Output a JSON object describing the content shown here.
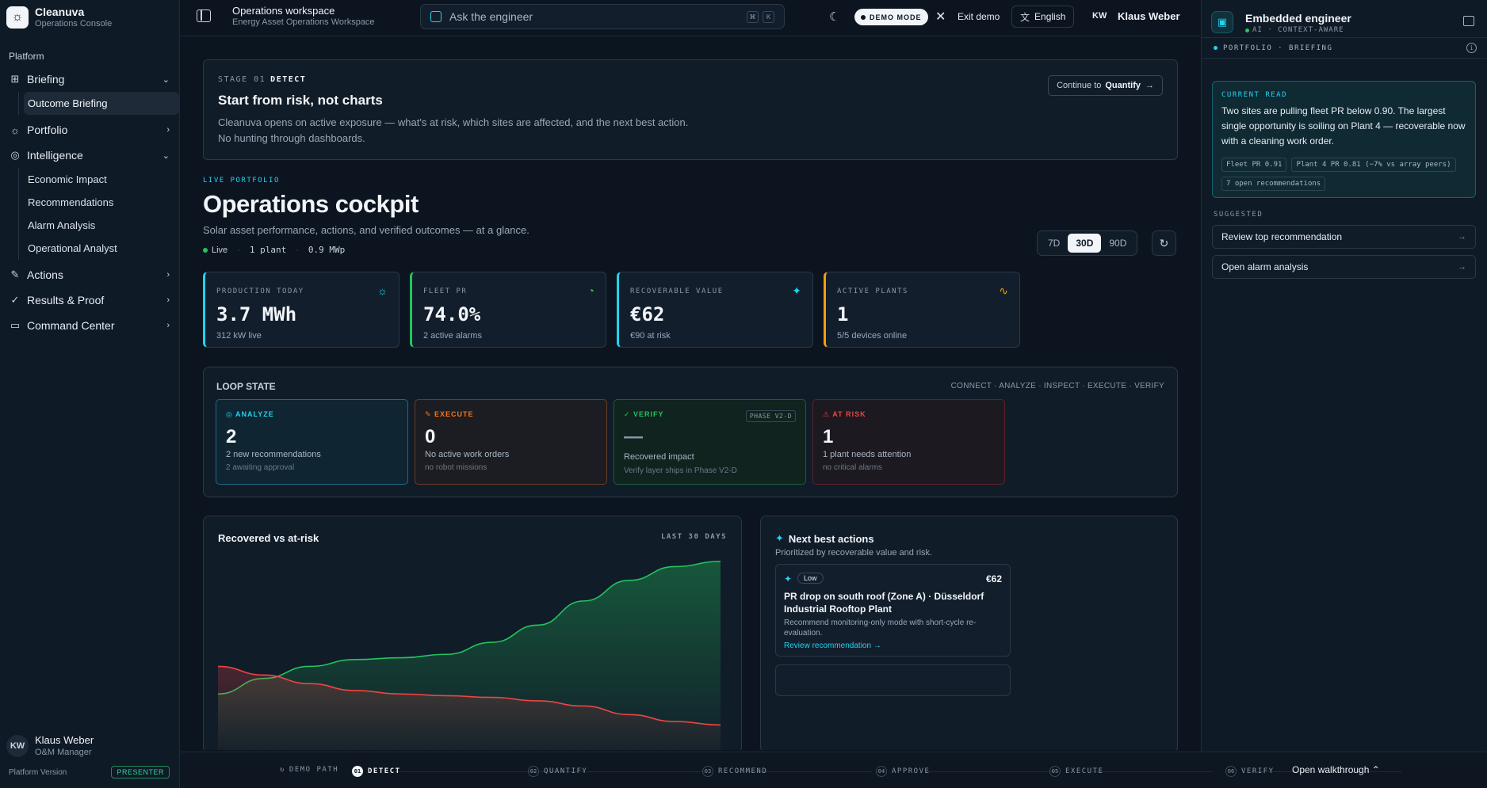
{
  "brand": {
    "name": "Cleanuva",
    "subtitle": "Operations Console"
  },
  "sidebar": {
    "section": "Platform",
    "items": [
      {
        "label": "Briefing",
        "icon": "grid-icon",
        "expanded": true,
        "children": [
          {
            "label": "Outcome Briefing",
            "active": true
          }
        ]
      },
      {
        "label": "Portfolio",
        "icon": "sun-icon",
        "expanded": false
      },
      {
        "label": "Intelligence",
        "icon": "brain-icon",
        "expanded": true,
        "children": [
          {
            "label": "Economic Impact"
          },
          {
            "label": "Recommendations"
          },
          {
            "label": "Alarm Analysis"
          },
          {
            "label": "Operational Analyst"
          }
        ]
      },
      {
        "label": "Actions",
        "icon": "wrench-icon",
        "expanded": false
      },
      {
        "label": "Results & Proof",
        "icon": "check-circle-icon",
        "expanded": false
      },
      {
        "label": "Command Center",
        "icon": "monitor-icon",
        "expanded": false
      }
    ],
    "user": {
      "initials": "KW",
      "name": "Klaus Weber",
      "role": "O&M Manager"
    },
    "footer": {
      "label": "Platform Version",
      "badge": "PRESENTER"
    }
  },
  "topbar": {
    "title": "Operations workspace",
    "subtitle": "Energy Asset Operations Workspace",
    "search_placeholder": "Ask the engineer",
    "kbd": [
      "⌘",
      "K"
    ],
    "demo_mode": "DEMO MODE",
    "exit": "Exit demo",
    "language": "English",
    "user_initials": "KW",
    "user_name": "Klaus Weber"
  },
  "stage": {
    "number": "STAGE 01",
    "name": "DETECT",
    "title": "Start from risk, not charts",
    "description": "Cleanuva opens on active exposure — what's at risk, which sites are affected, and the next best action. No hunting through dashboards.",
    "continue_prefix": "Continue to",
    "continue_target": "Quantify"
  },
  "cockpit": {
    "tag": "LIVE PORTFOLIO",
    "title": "Operations cockpit",
    "subtitle": "Solar asset performance, actions, and verified outcomes — at a glance.",
    "status": "Live",
    "plants": "1 plant",
    "capacity": "0.9 MWp",
    "ranges": [
      "7D",
      "30D",
      "90D"
    ],
    "selected_range": "30D"
  },
  "kpis": [
    {
      "label": "PRODUCTION TODAY",
      "value": "3.7 MWh",
      "sub": "312 kW live",
      "color": "#22d3ee",
      "icon": "sun-icon"
    },
    {
      "label": "FLEET PR",
      "value": "74.0%",
      "sub": "2 active alarms",
      "color": "#22c55e",
      "icon": "gauge-icon"
    },
    {
      "label": "RECOVERABLE VALUE",
      "value": "€62",
      "sub": "€90 at risk",
      "color": "#22d3ee",
      "icon": "sparkle-icon"
    },
    {
      "label": "ACTIVE PLANTS",
      "value": "1",
      "sub": "5/5 devices online",
      "color": "#f59e0b",
      "icon": "pulse-icon"
    }
  ],
  "loop": {
    "title": "LOOP STATE",
    "steps": "CONNECT · ANALYZE · INSPECT · EXECUTE · VERIFY",
    "cards": [
      {
        "label": "ANALYZE",
        "value": "2",
        "line1": "2 new recommendations",
        "line2": "2 awaiting approval",
        "color": "#22d3ee"
      },
      {
        "label": "EXECUTE",
        "value": "0",
        "line1": "No active work orders",
        "line2": "no robot missions",
        "color": "#f97316"
      },
      {
        "label": "VERIFY",
        "value": "—",
        "line1": "Recovered impact",
        "line2": "Verify layer ships in Phase V2-D",
        "badge": "PHASE V2-D",
        "color": "#22c55e"
      },
      {
        "label": "AT RISK",
        "value": "1",
        "line1": "1 plant needs attention",
        "line2": "no critical alarms",
        "color": "#ef4444"
      }
    ]
  },
  "chart": {
    "title": "Recovered vs at-risk",
    "range": "LAST 30 DAYS"
  },
  "chart_data": {
    "type": "area",
    "title": "Recovered vs at-risk",
    "xlabel": "",
    "ylabel": "",
    "series": [
      {
        "name": "",
        "color": "#22c55e",
        "values": [
          18,
          27,
          34,
          38,
          39,
          41,
          48,
          58,
          72,
          84,
          92,
          95
        ]
      },
      {
        "name": "",
        "color": "#ef4444",
        "values": [
          34,
          29,
          24,
          20,
          18,
          17,
          16,
          14,
          11,
          6,
          2,
          0
        ]
      }
    ],
    "ylim": [
      -15,
      100
    ],
    "grid": false
  },
  "nba": {
    "title": "Next best actions",
    "subtitle": "Prioritized by recoverable value and risk.",
    "item": {
      "priority": "Low",
      "value": "€62",
      "title": "PR drop on south roof (Zone A) · Düsseldorf Industrial Rooftop Plant",
      "desc": "Recommend monitoring-only mode with short-cycle re-evaluation.",
      "link": "Review recommendation →"
    }
  },
  "panel": {
    "title": "Embedded engineer",
    "subtitle": "AI · CONTEXT-AWARE",
    "context": "PORTFOLIO · BRIEFING",
    "read_label": "CURRENT READ",
    "read_text": "Two sites are pulling fleet PR below 0.90. The largest single opportunity is soiling on Plant 4 — recoverable now with a cleaning work order.",
    "chips": [
      "Fleet PR 0.91",
      "Plant 4 PR 0.81 (−7% vs array peers)",
      "7 open recommendations"
    ],
    "suggested_label": "SUGGESTED",
    "suggestions": [
      "Review top recommendation",
      "Open alarm analysis"
    ]
  },
  "walkthrough": {
    "demo_path": "DEMO PATH",
    "steps": [
      {
        "n": "01",
        "label": "DETECT",
        "active": true
      },
      {
        "n": "02",
        "label": "QUANTIFY"
      },
      {
        "n": "03",
        "label": "RECOMMEND"
      },
      {
        "n": "04",
        "label": "APPROVE"
      },
      {
        "n": "05",
        "label": "EXECUTE"
      },
      {
        "n": "06",
        "label": "VERIFY"
      }
    ],
    "open": "Open walkthrough"
  }
}
